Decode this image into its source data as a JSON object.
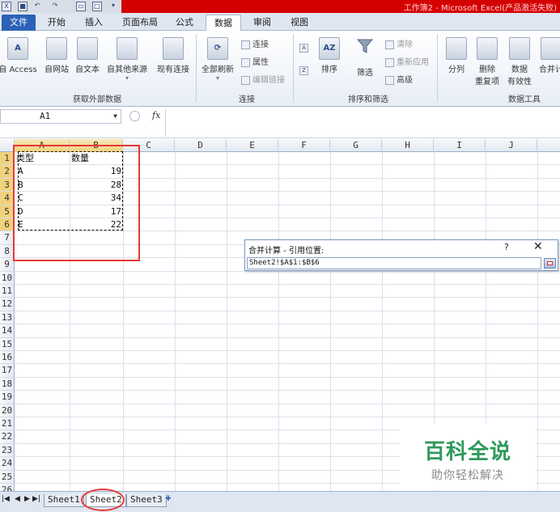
{
  "titlebar": {
    "title": "工作簿2 - Microsoft Excel(产品激活失败)",
    "colors": {
      "band": "#d40000"
    }
  },
  "ribbon_tabs": [
    "文件",
    "开始",
    "插入",
    "页面布局",
    "公式",
    "数据",
    "审阅",
    "视图"
  ],
  "ribbon": {
    "external": {
      "buttons": [
        "自 Access",
        "自网站",
        "自文本",
        "自其他来源",
        "现有连接"
      ],
      "label": "获取外部数据"
    },
    "connections": {
      "refresh_all": "全部刷新",
      "connect": "连接",
      "properties": "属性",
      "edit_links": "编辑链接",
      "label": "连接"
    },
    "sort_filter": {
      "sort": "排序",
      "filter": "筛选",
      "clear": "清除",
      "reapply": "重新应用",
      "advanced": "高级",
      "label": "排序和筛选"
    },
    "data_tools": {
      "split": "分列",
      "remove_dup_1": "删除",
      "remove_dup_2": "重复项",
      "validation_1": "数据",
      "validation_2": "有效性",
      "consolidate": "合并计",
      "label": "数据工具"
    }
  },
  "formula_bar": {
    "name_box": "A1",
    "fx": "fx",
    "formula": ""
  },
  "columns": [
    "A",
    "B",
    "C",
    "D",
    "E",
    "F",
    "G",
    "H",
    "I",
    "J"
  ],
  "rows": [
    "1",
    "2",
    "3",
    "4",
    "5",
    "6",
    "7",
    "8",
    "9",
    "10",
    "11",
    "12",
    "13",
    "14",
    "15",
    "16",
    "17",
    "18",
    "19",
    "20",
    "21",
    "22",
    "23",
    "24",
    "25",
    "26"
  ],
  "cells": {
    "headers": [
      "类型",
      "数量"
    ],
    "data": [
      {
        "type": "A",
        "qty": "19"
      },
      {
        "type": "B",
        "qty": "28"
      },
      {
        "type": "C",
        "qty": "34"
      },
      {
        "type": "D",
        "qty": "17"
      },
      {
        "type": "E",
        "qty": "22"
      }
    ]
  },
  "dialog": {
    "title": "合并计算 - 引用位置:",
    "help": "?",
    "close": "✕",
    "ref_value": "Sheet2!$A$1:$B$6"
  },
  "sheets": [
    "Sheet1",
    "Sheet2",
    "Sheet3"
  ],
  "active_sheet": "Sheet2",
  "watermark": {
    "main": "百科全说",
    "sub": "助你轻松解决"
  }
}
